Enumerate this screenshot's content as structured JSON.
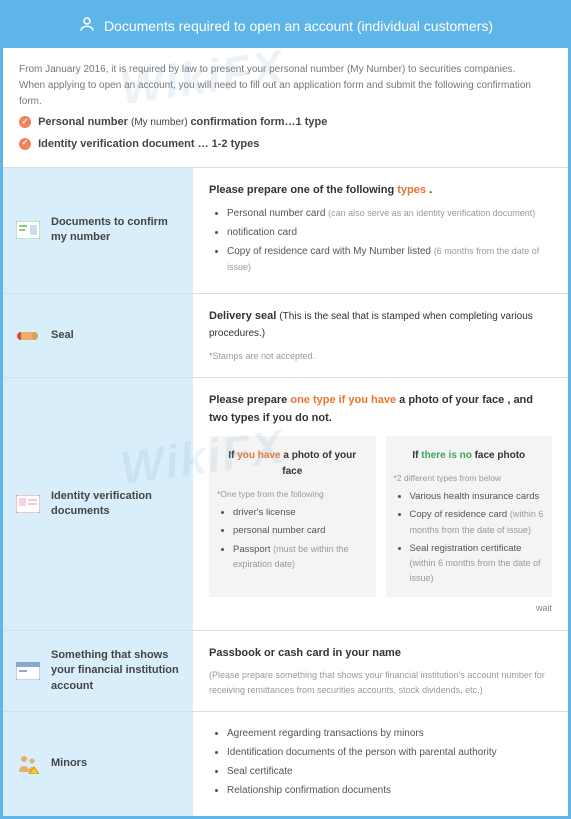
{
  "header": {
    "title": "Documents required to open an account (individual customers)"
  },
  "intro": {
    "line1": "From January 2016, it is required by law to present your personal number (My Number) to securities companies.",
    "line2": "When applying to open an account, you will need to fill out an application form and submit the following confirmation form.",
    "req1_a": "Personal number ",
    "req1_b": "(My number) ",
    "req1_c": "confirmation form…1 type",
    "req2": "Identity verification document … 1-2 types"
  },
  "sections": {
    "confirm_number": {
      "label": "Documents to confirm my number",
      "title_a": "Please prepare one of the following ",
      "title_b": "types ",
      "title_c": ".",
      "item1": "Personal number card ",
      "item1_note": "(can also serve as an identity verification document)",
      "item2": "notification card",
      "item3": "Copy of residence card with My Number listed ",
      "item3_note": "(6 months from the date of issue)"
    },
    "seal": {
      "label": "Seal",
      "title_a": "Delivery seal ",
      "title_b": "(This is the seal that is stamped when completing various procedures.)",
      "note": "*Stamps are not accepted."
    },
    "identity": {
      "label": "Identity verification documents",
      "title_a": "Please prepare ",
      "title_b": "one type if you have ",
      "title_c": "a photo of your face , and two types if you do not.",
      "caseA_head_a": "If ",
      "caseA_head_b": "you have ",
      "caseA_head_c": "a photo of your face",
      "caseA_note": "*One type from the following",
      "caseA_item1": "driver's license",
      "caseA_item2": "personal number card",
      "caseA_item3": "Passport ",
      "caseA_item3_note": "(must be within the expiration date)",
      "caseB_head_a": "If ",
      "caseB_head_b": "there is no ",
      "caseB_head_c": "face photo",
      "caseB_note": "*2 different types from below",
      "caseB_item1": "Various health insurance cards",
      "caseB_item2": "Copy of residence card ",
      "caseB_item2_note": "(within 6 months from the date of issue)",
      "caseB_item3": "Seal registration certificate ",
      "caseB_item3_note": "(within 6 months from the date of issue)",
      "wait": "wait"
    },
    "bank": {
      "label": "Something that shows your financial institution account",
      "title": "Passbook or cash card in your name",
      "note": "(Please prepare something that shows your financial institution's account number for receiving remittances from securities accounts, stock dividends, etc.)"
    },
    "minors": {
      "label": "Minors",
      "item1": "Agreement regarding transactions by minors",
      "item2": "Identification documents of the person with parental authority",
      "item3": "Seal certificate",
      "item4": "Relationship confirmation documents"
    }
  },
  "watermark": "WikiFX"
}
